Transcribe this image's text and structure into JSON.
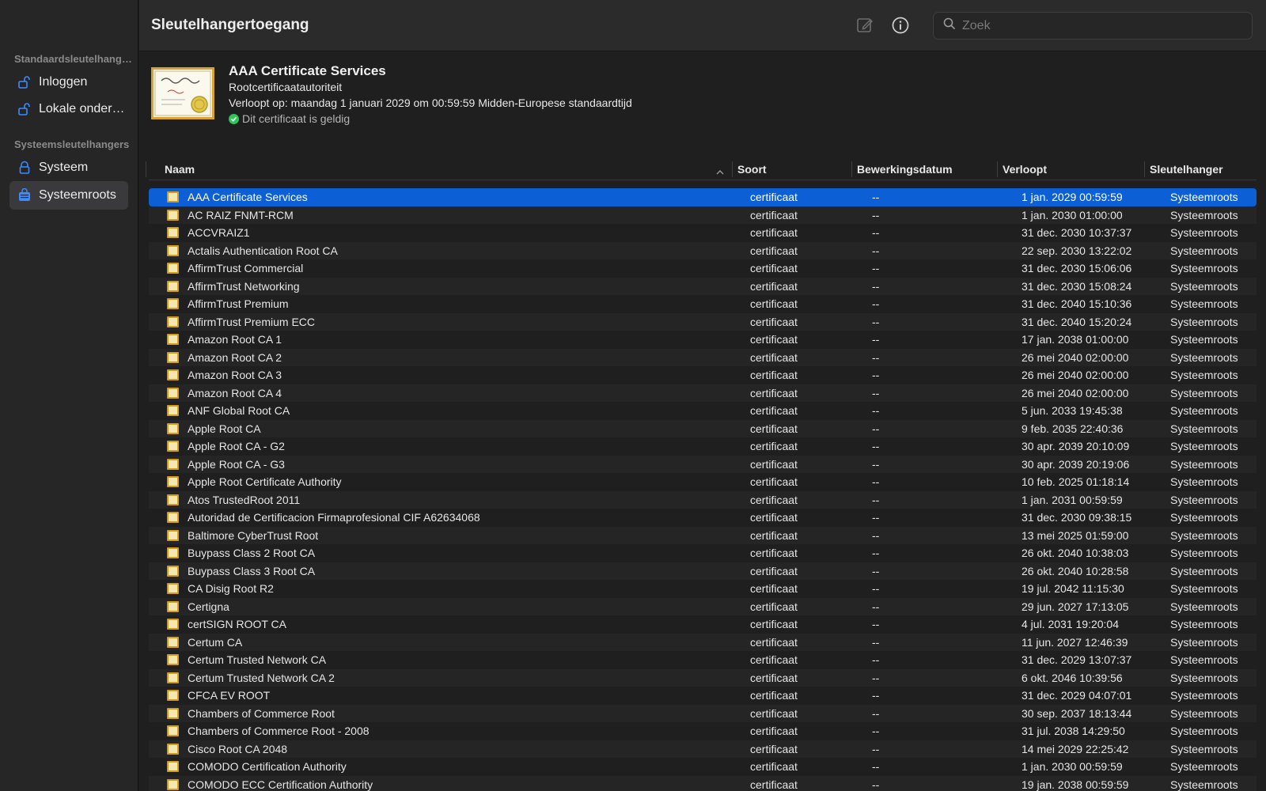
{
  "app": {
    "title": "Sleutelhangertoegang"
  },
  "search": {
    "placeholder": "Zoek",
    "icon": "search-icon"
  },
  "toolbar": {
    "edit_icon": "edit-icon",
    "info_icon": "info-icon"
  },
  "sidebar": {
    "sections": [
      {
        "label": "Standaardsleutelhangers",
        "items": [
          {
            "label": "Inloggen",
            "icon": "unlocked-padlock-icon"
          },
          {
            "label": "Lokale onderdelen",
            "icon": "unlocked-padlock-icon"
          }
        ]
      },
      {
        "label": "Systeemsleutelhangers",
        "items": [
          {
            "label": "Systeem",
            "icon": "padlock-icon"
          },
          {
            "label": "Systeemroots",
            "icon": "cabinet-icon",
            "selected": true
          }
        ]
      }
    ]
  },
  "detail": {
    "name": "AAA Certificate Services",
    "type": "Rootcertificaatautoriteit",
    "expiry": "Verloopt op: maandag 1 januari 2029 om 00:59:59 Midden-Europese standaardtijd",
    "valid": "Dit certificaat is geldig"
  },
  "table": {
    "columns": [
      "Naam",
      "Soort",
      "Bewerkingsdatum",
      "Verloopt",
      "Sleutelhanger"
    ],
    "rows": [
      [
        "AAA Certificate Services",
        "certificaat",
        "--",
        "1 jan. 2029 00:59:59",
        "Systeemroots"
      ],
      [
        "AC RAIZ FNMT-RCM",
        "certificaat",
        "--",
        "1 jan. 2030 01:00:00",
        "Systeemroots"
      ],
      [
        "ACCVRAIZ1",
        "certificaat",
        "--",
        "31 dec. 2030 10:37:37",
        "Systeemroots"
      ],
      [
        "Actalis Authentication Root CA",
        "certificaat",
        "--",
        "22 sep. 2030 13:22:02",
        "Systeemroots"
      ],
      [
        "AffirmTrust Commercial",
        "certificaat",
        "--",
        "31 dec. 2030 15:06:06",
        "Systeemroots"
      ],
      [
        "AffirmTrust Networking",
        "certificaat",
        "--",
        "31 dec. 2030 15:08:24",
        "Systeemroots"
      ],
      [
        "AffirmTrust Premium",
        "certificaat",
        "--",
        "31 dec. 2040 15:10:36",
        "Systeemroots"
      ],
      [
        "AffirmTrust Premium ECC",
        "certificaat",
        "--",
        "31 dec. 2040 15:20:24",
        "Systeemroots"
      ],
      [
        "Amazon Root CA 1",
        "certificaat",
        "--",
        "17 jan. 2038 01:00:00",
        "Systeemroots"
      ],
      [
        "Amazon Root CA 2",
        "certificaat",
        "--",
        "26 mei 2040 02:00:00",
        "Systeemroots"
      ],
      [
        "Amazon Root CA 3",
        "certificaat",
        "--",
        "26 mei 2040 02:00:00",
        "Systeemroots"
      ],
      [
        "Amazon Root CA 4",
        "certificaat",
        "--",
        "26 mei 2040 02:00:00",
        "Systeemroots"
      ],
      [
        "ANF Global Root CA",
        "certificaat",
        "--",
        "5 jun. 2033 19:45:38",
        "Systeemroots"
      ],
      [
        "Apple Root CA",
        "certificaat",
        "--",
        "9 feb. 2035 22:40:36",
        "Systeemroots"
      ],
      [
        "Apple Root CA - G2",
        "certificaat",
        "--",
        "30 apr. 2039 20:10:09",
        "Systeemroots"
      ],
      [
        "Apple Root CA - G3",
        "certificaat",
        "--",
        "30 apr. 2039 20:19:06",
        "Systeemroots"
      ],
      [
        "Apple Root Certificate Authority",
        "certificaat",
        "--",
        "10 feb. 2025 01:18:14",
        "Systeemroots"
      ],
      [
        "Atos TrustedRoot 2011",
        "certificaat",
        "--",
        "1 jan. 2031 00:59:59",
        "Systeemroots"
      ],
      [
        "Autoridad de Certificacion Firmaprofesional CIF A62634068",
        "certificaat",
        "--",
        "31 dec. 2030 09:38:15",
        "Systeemroots"
      ],
      [
        "Baltimore CyberTrust Root",
        "certificaat",
        "--",
        "13 mei 2025 01:59:00",
        "Systeemroots"
      ],
      [
        "Buypass Class 2 Root CA",
        "certificaat",
        "--",
        "26 okt. 2040 10:38:03",
        "Systeemroots"
      ],
      [
        "Buypass Class 3 Root CA",
        "certificaat",
        "--",
        "26 okt. 2040 10:28:58",
        "Systeemroots"
      ],
      [
        "CA Disig Root R2",
        "certificaat",
        "--",
        "19 jul. 2042 11:15:30",
        "Systeemroots"
      ],
      [
        "Certigna",
        "certificaat",
        "--",
        "29 jun. 2027 17:13:05",
        "Systeemroots"
      ],
      [
        "certSIGN ROOT CA",
        "certificaat",
        "--",
        "4 jul. 2031 19:20:04",
        "Systeemroots"
      ],
      [
        "Certum CA",
        "certificaat",
        "--",
        "11 jun. 2027 12:46:39",
        "Systeemroots"
      ],
      [
        "Certum Trusted Network CA",
        "certificaat",
        "--",
        "31 dec. 2029 13:07:37",
        "Systeemroots"
      ],
      [
        "Certum Trusted Network CA 2",
        "certificaat",
        "--",
        "6 okt. 2046 10:39:56",
        "Systeemroots"
      ],
      [
        "CFCA EV ROOT",
        "certificaat",
        "--",
        "31 dec. 2029 04:07:01",
        "Systeemroots"
      ],
      [
        "Chambers of Commerce Root",
        "certificaat",
        "--",
        "30 sep. 2037 18:13:44",
        "Systeemroots"
      ],
      [
        "Chambers of Commerce Root - 2008",
        "certificaat",
        "--",
        "31 jul. 2038 14:29:50",
        "Systeemroots"
      ],
      [
        "Cisco Root CA 2048",
        "certificaat",
        "--",
        "14 mei 2029 22:25:42",
        "Systeemroots"
      ],
      [
        "COMODO Certification Authority",
        "certificaat",
        "--",
        "1 jan. 2030 00:59:59",
        "Systeemroots"
      ],
      [
        "COMODO ECC Certification Authority",
        "certificaat",
        "--",
        "19 jan. 2038 00:59:59",
        "Systeemroots"
      ]
    ],
    "selected_row": 0
  },
  "colors": {
    "selection": "#0d5fd6",
    "cert_border": "#d59b1b",
    "valid": "#2ec55a"
  }
}
